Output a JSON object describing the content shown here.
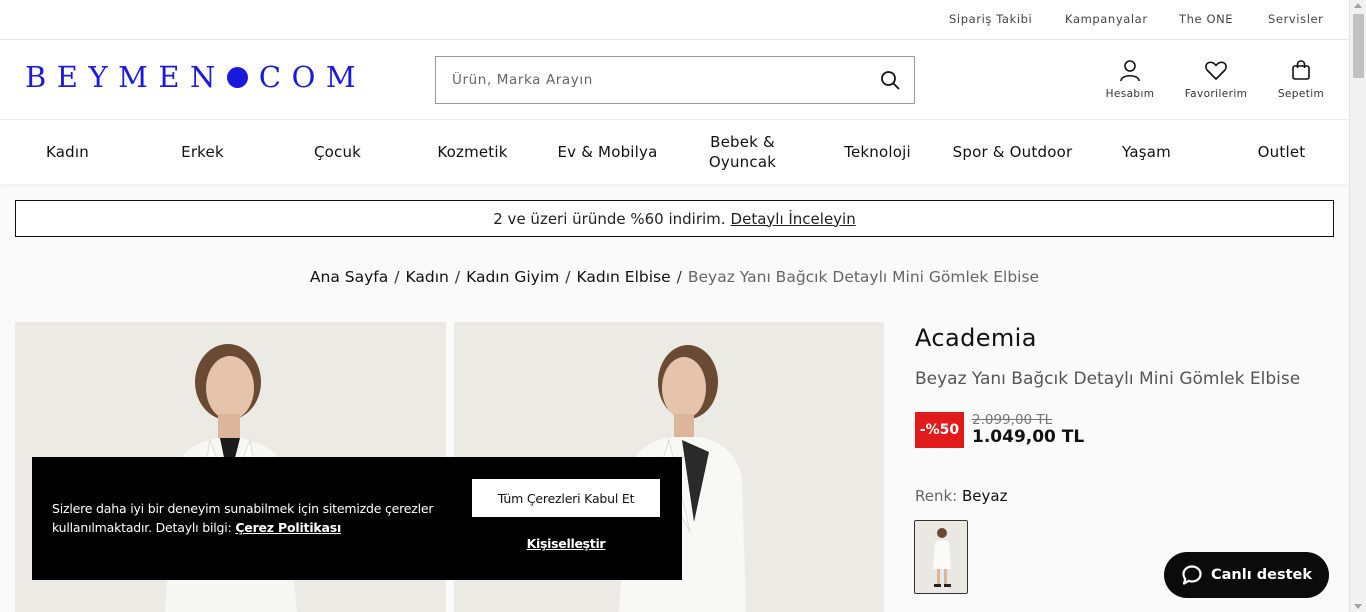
{
  "topbar": {
    "links": [
      "Sipariş Takibi",
      "Kampanyalar",
      "The ONE",
      "Servisler"
    ]
  },
  "header": {
    "logo_left": "BEYMEN",
    "logo_right": "COM",
    "search_placeholder": "Ürün, Marka Arayın",
    "icons": [
      {
        "label": "Hesabım",
        "icon": "user-icon"
      },
      {
        "label": "Favorilerim",
        "icon": "heart-icon"
      },
      {
        "label": "Sepetim",
        "icon": "shopping-bag-icon"
      }
    ],
    "brand_color": "#1a1adf"
  },
  "nav": {
    "items": [
      "Kadın",
      "Erkek",
      "Çocuk",
      "Kozmetik",
      "Ev & Mobilya",
      "Bebek &\nOyuncak",
      "Teknoloji",
      "Spor & Outdoor",
      "Yaşam",
      "Outlet"
    ]
  },
  "promo": {
    "text": "2 ve üzeri üründe %60 indirim.",
    "link": "Detaylı İnceleyin"
  },
  "breadcrumb": {
    "items": [
      "Ana Sayfa",
      "Kadın",
      "Kadın Giyim",
      "Kadın Elbise"
    ],
    "current": "Beyaz Yanı Bağcık Detaylı Mini Gömlek Elbise"
  },
  "product": {
    "brand": "Academia",
    "name": "Beyaz Yanı Bağcık Detaylı Mini Gömlek Elbise",
    "discount": "-%50",
    "old_price": "2.099,00 TL",
    "new_price": "1.049,00 TL",
    "color_label": "Renk:",
    "color_value": "Beyaz",
    "discount_color": "#e11b1b"
  },
  "cookie": {
    "text": "Sizlere daha iyi bir deneyim sunabilmek için sitemizde çerezler kullanılmaktadır. Detaylı bilgi:",
    "policy_link": "Çerez Politikası",
    "accept_label": "Tüm Çerezleri Kabul Et",
    "customize_label": "Kişiselleştir"
  },
  "support": {
    "label": "Canlı destek"
  }
}
